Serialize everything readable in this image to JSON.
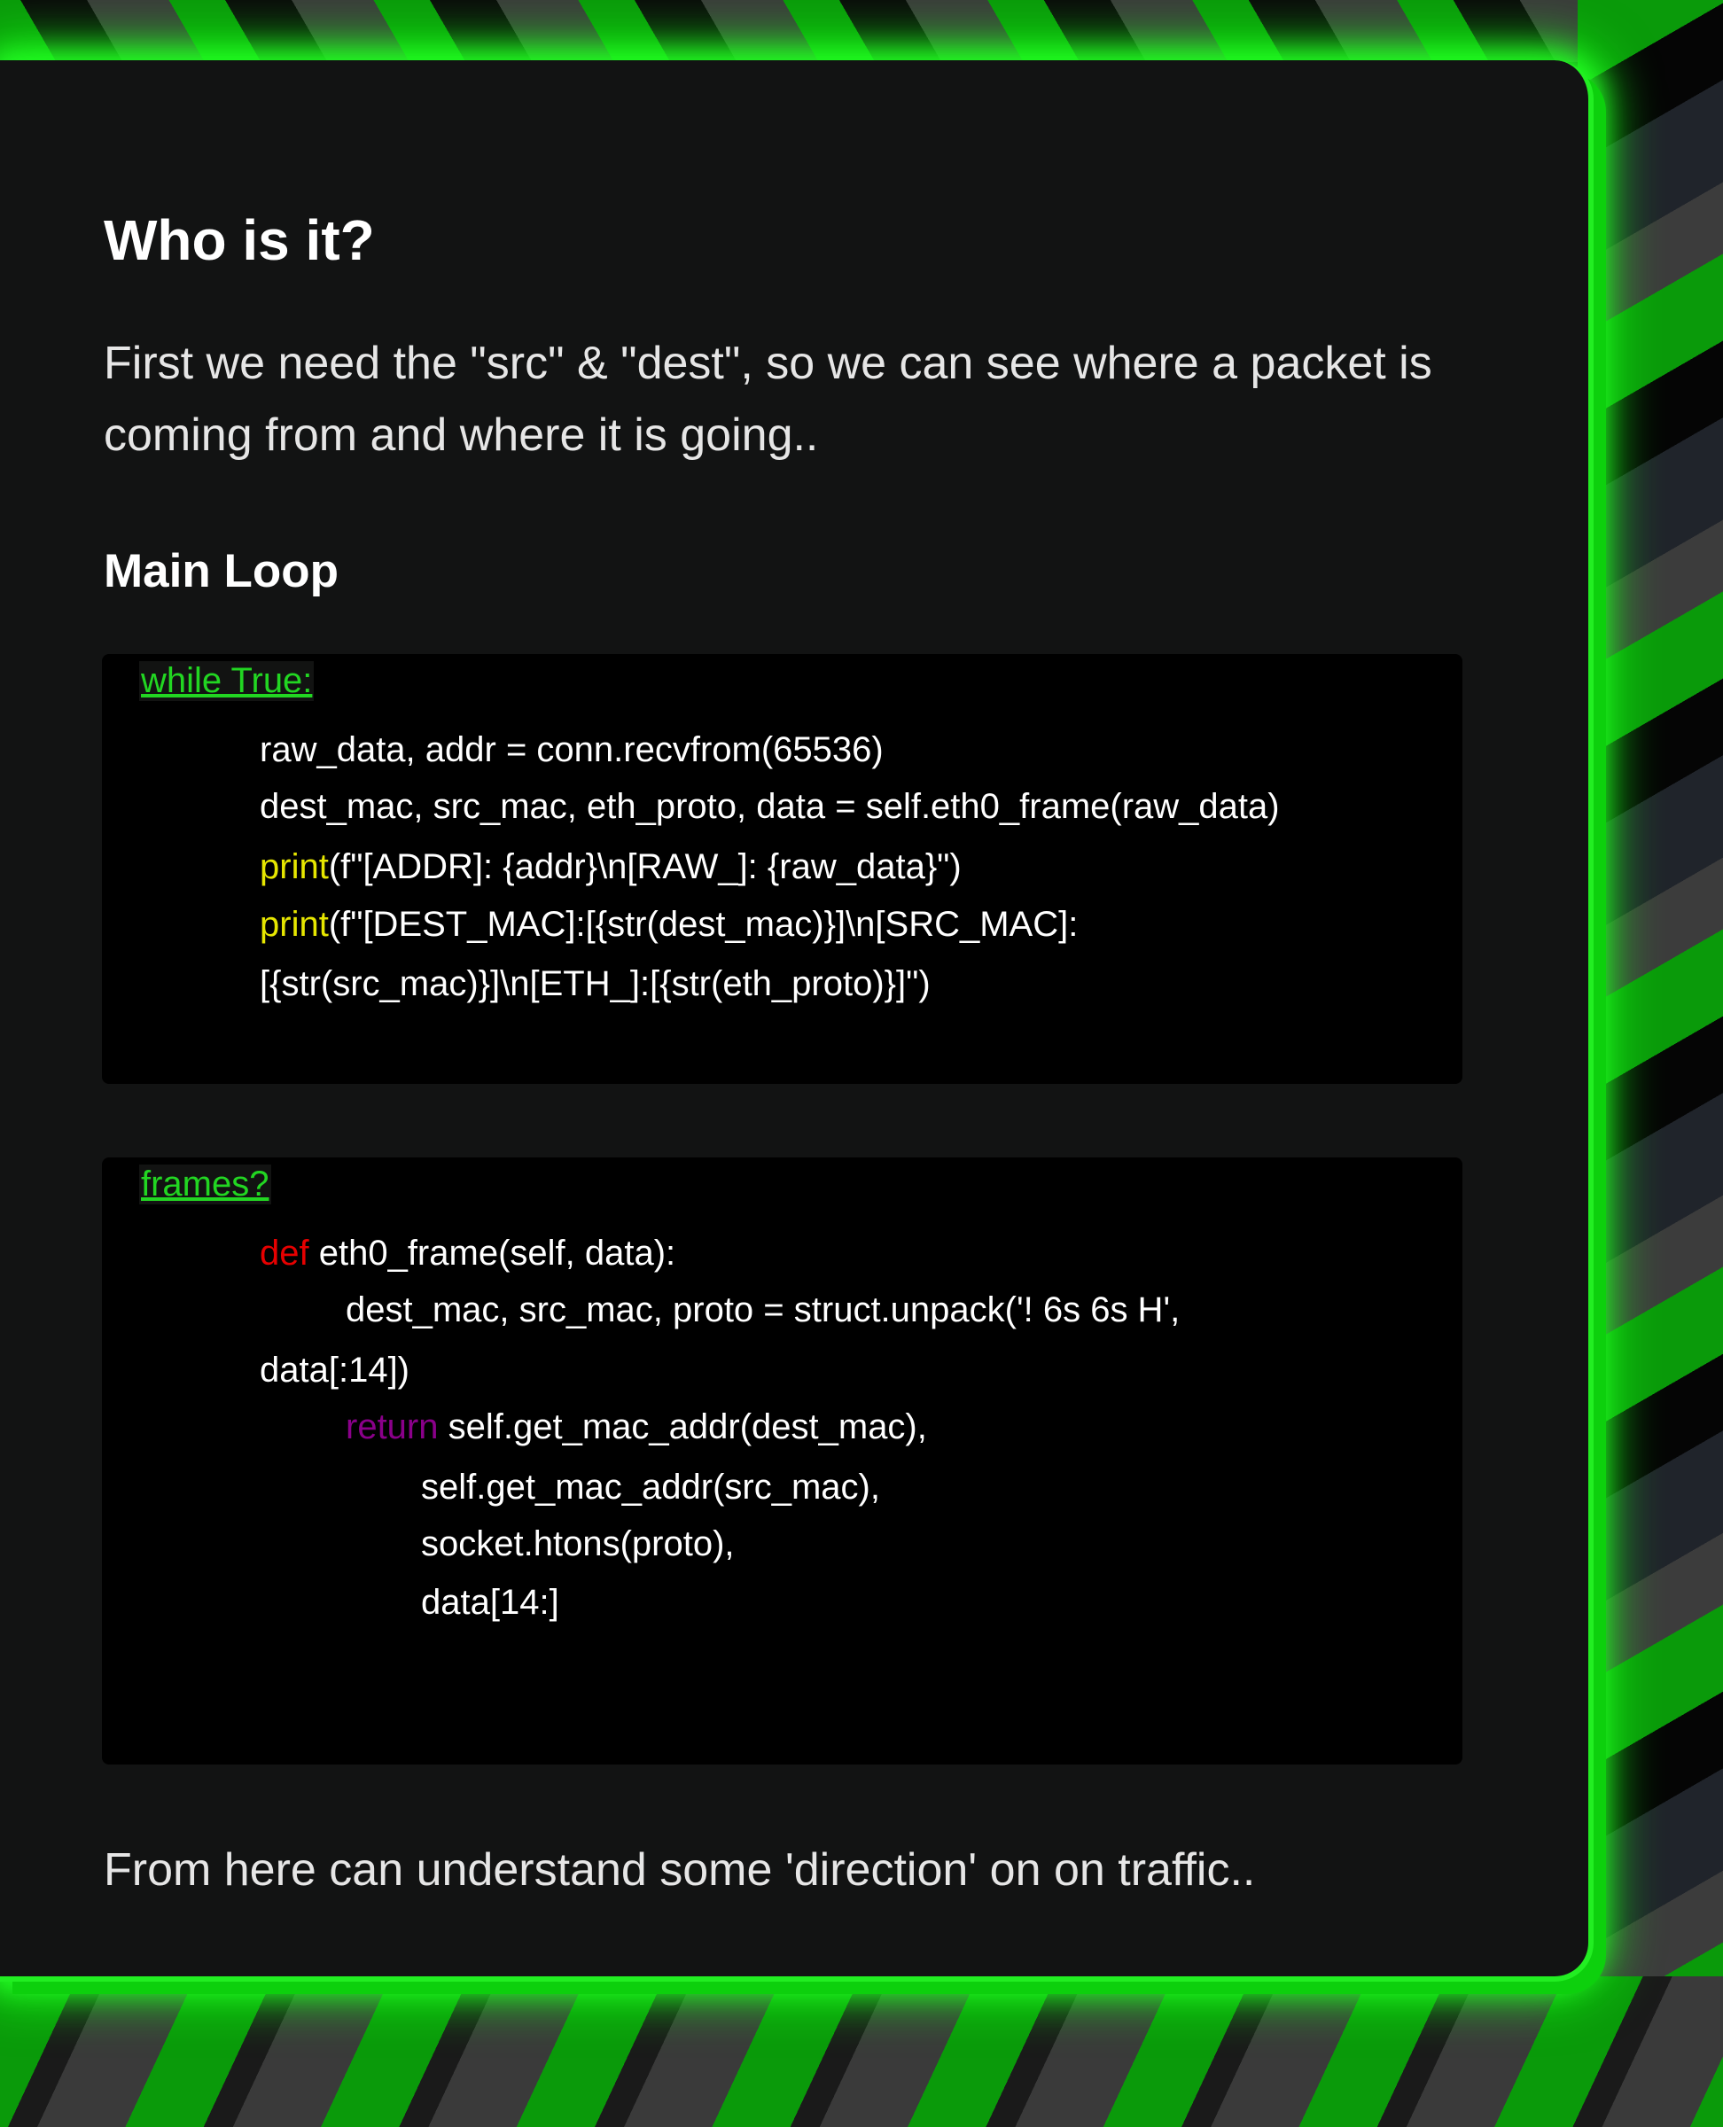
{
  "article": {
    "heading": "Who is it?",
    "intro": "First we need the \"src\" & \"dest\", so we can see where a packet is coming from and where it is going..",
    "subheading": "Main Loop",
    "outro": "From here can understand some 'direction' on on traffic.."
  },
  "loop_block": {
    "title": "while True:",
    "line1": "raw_data, addr = conn.recvfrom(65536)",
    "line2": "dest_mac, src_mac, eth_proto, data = self.eth0_frame(raw_data)",
    "line3_kw": "print",
    "line3_rest": "(f\"[ADDR]: {addr}\\n[RAW_]: {raw_data}\")",
    "line4_kw": "print",
    "line4_rest": "(f\"[DEST_MAC]:[{str(dest_mac)}]\\n[SRC_MAC]:",
    "line5": "[{str(src_mac)}]\\n[ETH_]:[{str(eth_proto)}]\")"
  },
  "frames_block": {
    "title": "frames?",
    "line1_kw": "def",
    "line1_rest": " eth0_frame(self, data):",
    "line2": "dest_mac, src_mac, proto = struct.unpack('! 6s 6s H',",
    "line3": "data[:14])",
    "line4_kw": "return",
    "line4_rest": " self.get_mac_addr(dest_mac),",
    "line5": "self.get_mac_addr(src_mac),",
    "line6": "socket.htons(proto),",
    "line7": "data[14:]"
  },
  "colors": {
    "accent_green": "#22ee22",
    "card_bg": "#121313",
    "code_bg": "#000000",
    "keyword_print": "#e6e600",
    "keyword_def": "#e60000",
    "keyword_return": "#8a008a"
  }
}
